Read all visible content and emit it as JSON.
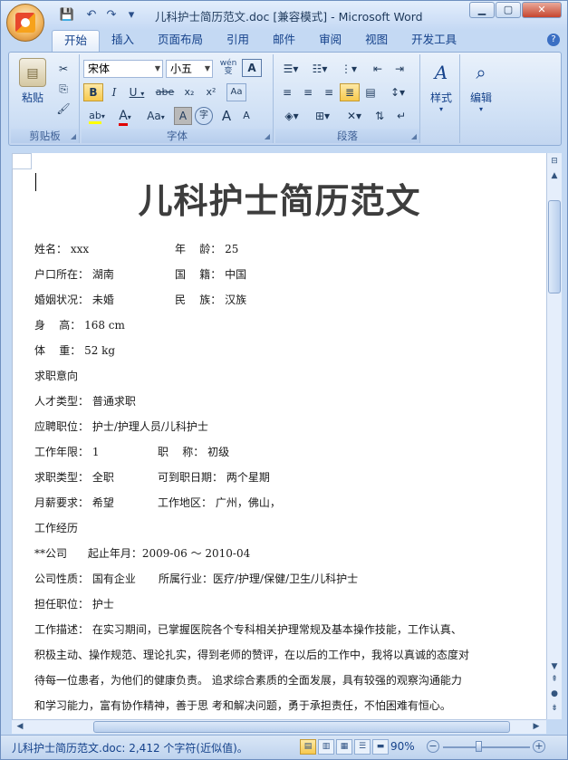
{
  "window": {
    "title": "儿科护士简历范文.doc [兼容模式] - Microsoft Word",
    "minimize": "▁",
    "maximize": "▢",
    "close": "✕"
  },
  "qat": {
    "save": "💾",
    "undo": "↶",
    "redo": "↷",
    "more": "▾"
  },
  "tabs": [
    "开始",
    "插入",
    "页面布局",
    "引用",
    "邮件",
    "审阅",
    "视图",
    "开发工具"
  ],
  "help": "?",
  "ribbon": {
    "clipboard": {
      "label": "剪贴板",
      "paste": "粘贴",
      "cut": "✂",
      "copy": "⎘",
      "painter": "🖌"
    },
    "font": {
      "label": "字体",
      "name": "宋体",
      "size": "小五",
      "wen": "wén\n变",
      "charborder": "A",
      "bold": "B",
      "italic": "I",
      "underline": "U",
      "strike": "abe",
      "sub": "x₂",
      "sup": "x²",
      "clear": "Aa",
      "highlight": "ab",
      "color": "A",
      "case": "Aa",
      "shade": "A",
      "circle": "字",
      "grow": "A",
      "shrink": "A"
    },
    "paragraph": {
      "label": "段落"
    },
    "styles": {
      "label": "样式"
    },
    "editing": {
      "label": "编辑"
    }
  },
  "document": {
    "title": "儿科护士简历范文",
    "lines": [
      [
        "姓名： xxx",
        "年    龄： 25"
      ],
      [
        "户口所在： 湖南",
        "国    籍： 中国"
      ],
      [
        "婚姻状况： 未婚",
        "民    族： 汉族"
      ],
      [
        "身    高： 168 cm",
        ""
      ],
      [
        "体    重： 52 kg",
        ""
      ],
      [
        "求职意向",
        ""
      ],
      [
        "人才类型： 普通求职",
        ""
      ],
      [
        "应聘职位： 护士/护理人员/儿科护士",
        ""
      ],
      [
        "工作年限： 1",
        "职    称： 初级"
      ],
      [
        "求职类型： 全职",
        "可到职日期： 两个星期"
      ],
      [
        "月薪要求： 希望",
        "工作地区： 广州，佛山，"
      ],
      [
        "工作经历",
        ""
      ],
      [
        "**公司      起止年月：2009-06 ～ 2010-04",
        ""
      ],
      [
        "公司性质： 国有企业",
        "所属行业：医疗/护理/保健/卫生/儿科护士"
      ],
      [
        "担任职位： 护士",
        ""
      ],
      [
        "工作描述： 在实习期间，已掌握医院各个专科相关护理常规及基本操作技能，工作认真、",
        ""
      ],
      [
        "积极主动、操作规范、理论扎实，得到老师的赞评，在以后的工作中，我将以真诚的态度对",
        ""
      ],
      [
        "待每一位患者，为他们的健康负责。 追求综合素质的全面发展，具有较强的观察沟通能力",
        ""
      ],
      [
        "和学习能力，富有协作精神，善于思 考和解决问题，勇于承担责任，不怕困难有恒心。",
        ""
      ]
    ]
  },
  "status": {
    "text": "儿科护士简历范文.doc: 2,412 个字符(近似值)。",
    "zoom": "90%",
    "minus": "−",
    "plus": "+"
  },
  "colors": {
    "accent": "#15428b",
    "highlight": "#f7c94d"
  }
}
